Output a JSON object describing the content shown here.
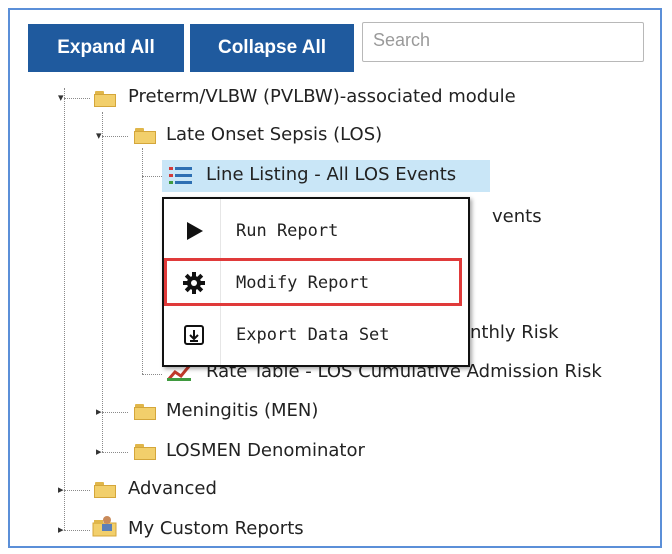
{
  "toolbar": {
    "expand_all_label": "Expand All",
    "collapse_all_label": "Collapse All",
    "search_placeholder": "Search"
  },
  "tree": {
    "preterm_module": "Preterm/VLBW (PVLBW)-associated module",
    "late_onset_sepsis": "Late Onset Sepsis (LOS)",
    "line_listing": "Line Listing - All LOS Events",
    "hidden_item_2_tail": "vents",
    "hidden_item_5_tail": "nthly Risk",
    "rate_table_cumulative": "Rate Table - LOS Cumulative Admission Risk",
    "meningitis": "Meningitis (MEN)",
    "losmen_denominator": "LOSMEN Denominator",
    "advanced": "Advanced",
    "my_custom_reports": "My Custom Reports"
  },
  "context_menu": {
    "run_report": "Run Report",
    "modify_report": "Modify Report",
    "export_data_set": "Export Data Set"
  },
  "colors": {
    "button_bg": "#1f5a9e",
    "frame_border": "#5b8fd8",
    "selection_bg": "#c9e6f7",
    "highlight_border": "#e03a3a",
    "folder_fill": "#f2cf6b"
  }
}
